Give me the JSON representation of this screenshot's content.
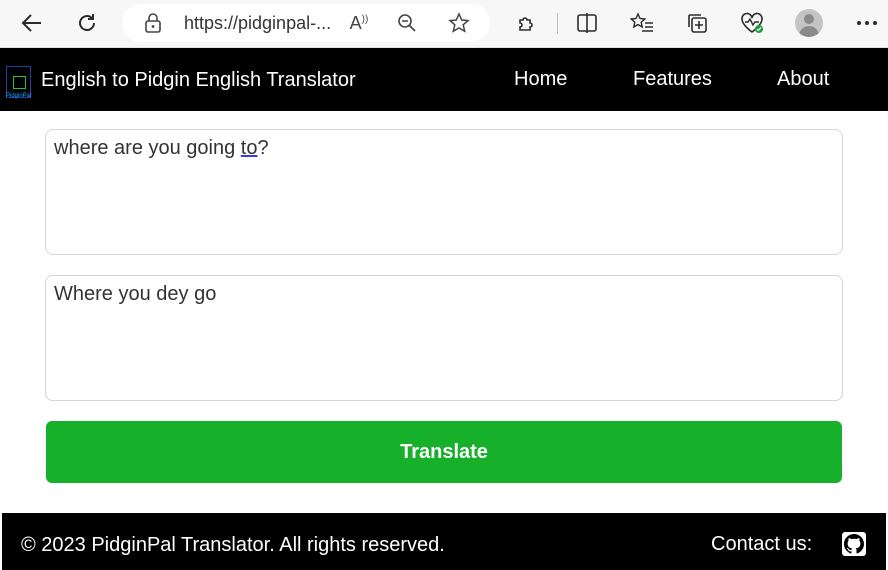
{
  "browser": {
    "url": "https://pidginpal-...",
    "icons": [
      "back-arrow-icon",
      "refresh-icon",
      "lock-icon",
      "read-aloud-icon",
      "zoom-out-icon",
      "favorite-star-icon",
      "extensions-icon",
      "split-screen-icon",
      "favorites-list-icon",
      "collections-icon",
      "browser-essentials-icon",
      "profile-avatar-icon",
      "more-menu-icon"
    ],
    "read_aloud_glyph": "A"
  },
  "header": {
    "title": "English to Pidgin English Translator",
    "logo_text": "PidginPal",
    "nav": [
      "Home",
      "Features",
      "About"
    ]
  },
  "main": {
    "input_text_before": "where are you going ",
    "input_text_underlined": "to",
    "input_text_after": "?",
    "output_text": "Where you dey go",
    "translate_label": "Translate",
    "accent_color": "#16b02a"
  },
  "footer": {
    "copyright": "© 2023 PidginPal Translator. All rights reserved.",
    "contact_label": "Contact us:"
  }
}
